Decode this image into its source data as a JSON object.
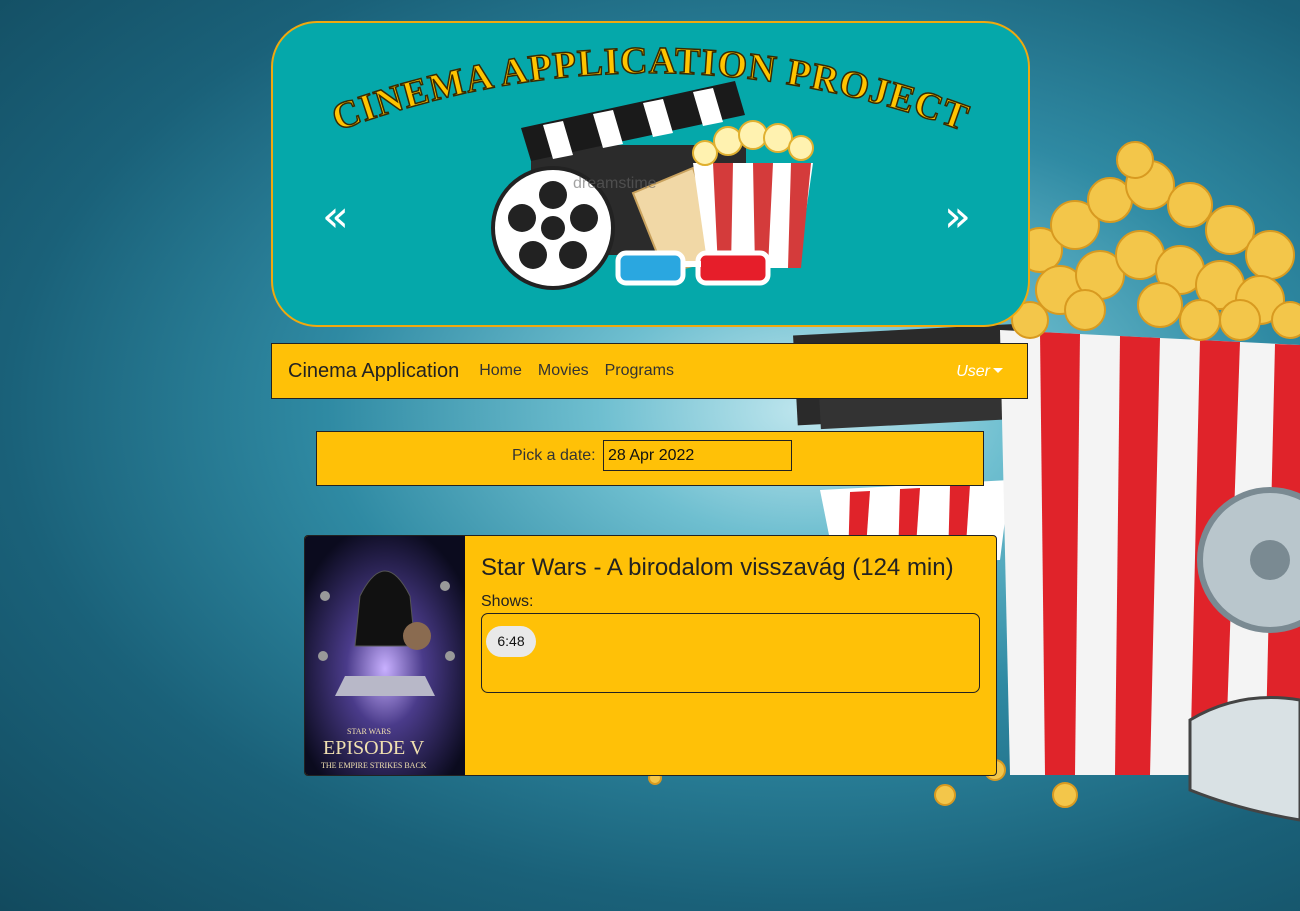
{
  "banner": {
    "title": "CINEMA APPLICATION PROJECT",
    "prev_label": "«",
    "next_label": "»",
    "watermark": "dreamstime"
  },
  "navbar": {
    "brand": "Cinema Application",
    "links": [
      "Home",
      "Movies",
      "Programs"
    ],
    "user_label": "User"
  },
  "date_picker": {
    "label": "Pick a date:",
    "value": "28 Apr 2022"
  },
  "movies": [
    {
      "title": "Star Wars - A birodalom visszavág (124 min)",
      "poster_text": [
        "STAR WARS",
        "EPISODE V",
        "THE EMPIRE STRIKES BACK"
      ],
      "shows_label": "Shows:",
      "shows": [
        "6:48"
      ]
    }
  ],
  "colors": {
    "accent": "#ffc107",
    "banner_bg": "#05a8aa",
    "banner_border": "#f0a90e",
    "title_text": "#ffc400"
  }
}
